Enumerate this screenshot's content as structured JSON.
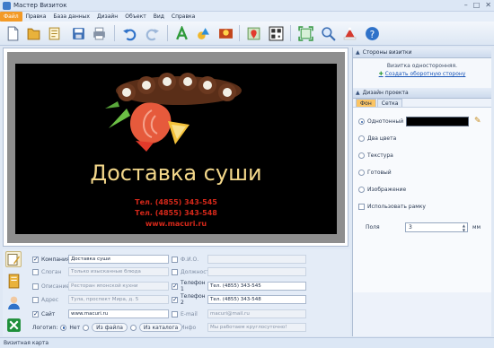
{
  "window": {
    "title": "Мастер Визиток",
    "controls": [
      "–",
      "□",
      "✕"
    ]
  },
  "menu": [
    "Файл",
    "Правка",
    "База данных",
    "Дизайн",
    "Объект",
    "Вид",
    "Справка"
  ],
  "menu_active": "Файл",
  "toolbar_icons": [
    "new-icon",
    "open-icon",
    "template-icon",
    "save-icon",
    "print-icon",
    "undo-icon",
    "redo-icon",
    "text-icon",
    "shapes-icon",
    "image-icon",
    "map-icon",
    "qrcode-icon",
    "fit-icon",
    "zoom-icon",
    "christmas-icon",
    "help-icon"
  ],
  "card": {
    "company": "Доставка суши",
    "phone1": "Тел. (4855) 343-545",
    "phone2": "Тел. (4855) 343-548",
    "site": "www.macuri.ru",
    "colors": {
      "background": "#000000",
      "company": "#f3d78a",
      "contacts": "#d5281a"
    }
  },
  "right_panel": {
    "sides_title": "Стороны визитки",
    "sides_message": "Визитка односторонняя.",
    "sides_link": "Создать оборотную сторону",
    "design_title": "Дизайн проекта",
    "tabs": [
      "Фон",
      "Сетка"
    ],
    "fill_options": [
      "Однотонный",
      "Два цвета",
      "Текстура",
      "Готовый",
      "Изображение"
    ],
    "fill_selected": "Однотонный",
    "fill_color": "#000000",
    "use_frame_label": "Использовать рамку",
    "use_frame": false,
    "margin_label": "Поля",
    "margin_value": "3",
    "margin_unit": "мм"
  },
  "fields": {
    "company": {
      "label": "Компания",
      "value": "Доставка суши",
      "checked": true
    },
    "slogan": {
      "label": "Слоган",
      "value": "Только изысканные блюда",
      "checked": false
    },
    "description": {
      "label": "Описание",
      "value": "Ресторан японской кухни",
      "checked": false
    },
    "address": {
      "label": "Адрес",
      "value": "Тула, проспект Мира, д. 5",
      "checked": false
    },
    "site": {
      "label": "Сайт",
      "value": "www.macuri.ru",
      "checked": true
    },
    "fio": {
      "label": "Ф.И.О.",
      "value": "",
      "checked": false
    },
    "position": {
      "label": "Должность",
      "value": "",
      "checked": false
    },
    "phone1": {
      "label": "Телефон 1",
      "value": "Тел. (4855) 343-545",
      "checked": true
    },
    "phone2": {
      "label": "Телефон 2",
      "value": "Тел. (4855) 343-548",
      "checked": true
    },
    "email": {
      "label": "E-mail",
      "value": "macuri@mail.ru",
      "checked": false
    },
    "info": {
      "label": "Инфо",
      "value": "Мы работаем круглосуточно!",
      "checked": false
    }
  },
  "logo": {
    "label": "Логотип:",
    "options": [
      "Нет",
      "Из файла",
      "Из каталога"
    ],
    "selected": "Нет"
  },
  "status": "Визитная карта"
}
